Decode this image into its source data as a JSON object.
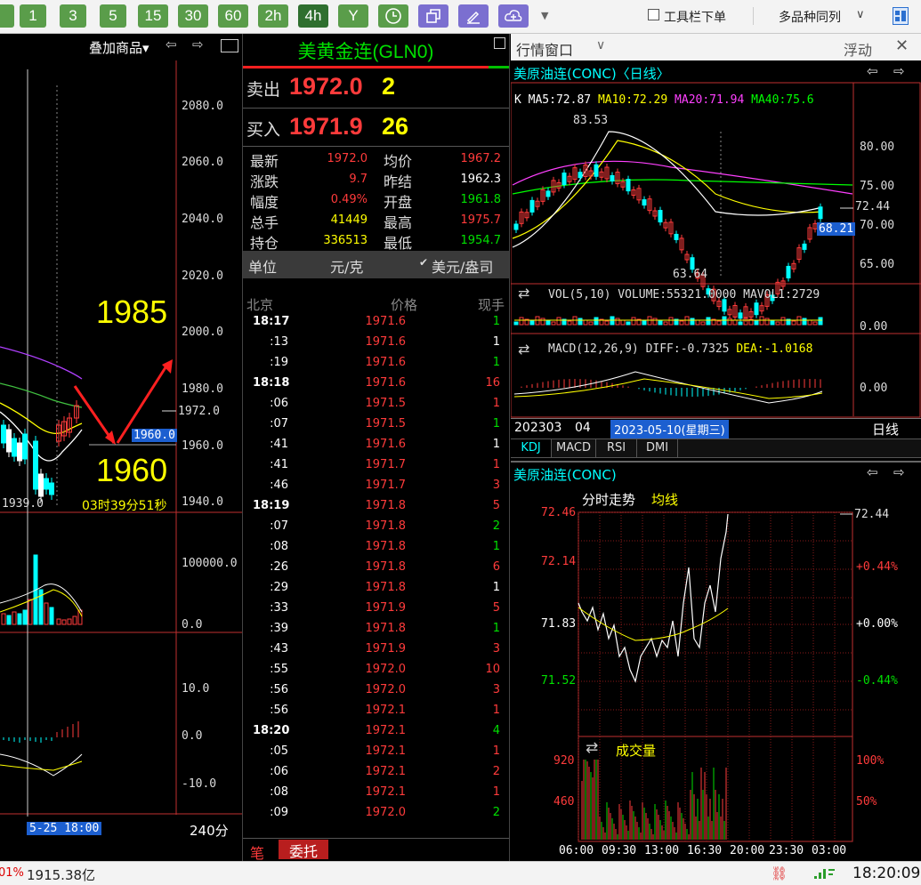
{
  "toolbar": {
    "buttons": [
      "1",
      "3",
      "5",
      "15",
      "30",
      "60",
      "2h",
      "4h",
      "Y"
    ],
    "toolbar_dock_label": "工具栏下单",
    "multi_layout_label": "多品种同列"
  },
  "left_chart": {
    "overlay_label": "叠加商品▾",
    "price_ticks": [
      "2080.0",
      "2060.0",
      "2040.0",
      "2020.0",
      "2000.0",
      "1980.0",
      "1960.0",
      "1940.0"
    ],
    "marker_high": "1985",
    "marker_low": "1960",
    "last_price_tag": "1972.0",
    "cursor_price_tag": "1960.0",
    "low_label": "1939.0",
    "countdown": "03时39分51秒",
    "vol_ticks": [
      "100000.0",
      "0.0"
    ],
    "macd_ticks": [
      "10.0",
      "0.0",
      "-10.0"
    ],
    "date_cursor": "5-25 18:00",
    "period": "240分",
    "colors": {
      "volume_up": "#ff3b3b",
      "volume_down": "#00ffff",
      "ma_yellow": "#ffff00",
      "ma_purple": "#b040ff"
    }
  },
  "quote": {
    "title": "美黄金连(GLN0)",
    "ask_label": "卖出",
    "ask_price": "1972.0",
    "ask_size": "2",
    "bid_label": "买入",
    "bid_price": "1971.9",
    "bid_size": "26",
    "fields": [
      {
        "l1": "最新",
        "v1": "1972.0",
        "c1": "#ff3b3b",
        "l2": "均价",
        "v2": "1967.2",
        "c2": "#ff3b3b"
      },
      {
        "l1": "涨跌",
        "v1": "9.7",
        "c1": "#ff3b3b",
        "l2": "昨结",
        "v2": "1962.3",
        "c2": "#ffffff"
      },
      {
        "l1": "幅度",
        "v1": "0.49%",
        "c1": "#ff3b3b",
        "l2": "开盘",
        "v2": "1961.8",
        "c2": "#00e000"
      },
      {
        "l1": "总手",
        "v1": "41449",
        "c1": "#ffff00",
        "l2": "最高",
        "v2": "1975.7",
        "c2": "#ff3b3b"
      },
      {
        "l1": "持仓",
        "v1": "336513",
        "c1": "#ffff00",
        "l2": "最低",
        "v2": "1954.7",
        "c2": "#00e000"
      }
    ],
    "unit_label": "单位",
    "unit_cny": "元/克",
    "unit_usd": "美元/盎司",
    "tick_headers": {
      "time": "北京",
      "price": "价格",
      "vol": "现手"
    },
    "ticks": [
      {
        "t": "18:17",
        "p": "1971.6",
        "v": "1",
        "c": "#00e000",
        "b": true
      },
      {
        "t": ":13",
        "p": "1971.6",
        "v": "1",
        "c": "#ffffff"
      },
      {
        "t": ":19",
        "p": "1971.6",
        "v": "1",
        "c": "#00e000"
      },
      {
        "t": "18:18",
        "p": "1971.6",
        "v": "16",
        "c": "#ff3b3b",
        "b": true
      },
      {
        "t": ":06",
        "p": "1971.5",
        "v": "1",
        "c": "#ff3b3b"
      },
      {
        "t": ":07",
        "p": "1971.5",
        "v": "1",
        "c": "#00e000"
      },
      {
        "t": ":41",
        "p": "1971.6",
        "v": "1",
        "c": "#ffffff"
      },
      {
        "t": ":41",
        "p": "1971.7",
        "v": "1",
        "c": "#ff3b3b"
      },
      {
        "t": ":46",
        "p": "1971.7",
        "v": "3",
        "c": "#ff3b3b"
      },
      {
        "t": "18:19",
        "p": "1971.8",
        "v": "5",
        "c": "#ff3b3b",
        "b": true
      },
      {
        "t": ":07",
        "p": "1971.8",
        "v": "2",
        "c": "#00e000"
      },
      {
        "t": ":08",
        "p": "1971.8",
        "v": "1",
        "c": "#00e000"
      },
      {
        "t": ":26",
        "p": "1971.8",
        "v": "6",
        "c": "#ff3b3b"
      },
      {
        "t": ":29",
        "p": "1971.8",
        "v": "1",
        "c": "#ffffff"
      },
      {
        "t": ":33",
        "p": "1971.9",
        "v": "5",
        "c": "#ff3b3b"
      },
      {
        "t": ":39",
        "p": "1971.8",
        "v": "1",
        "c": "#00e000"
      },
      {
        "t": ":43",
        "p": "1971.9",
        "v": "3",
        "c": "#ff3b3b"
      },
      {
        "t": ":55",
        "p": "1972.0",
        "v": "10",
        "c": "#ff3b3b"
      },
      {
        "t": ":56",
        "p": "1972.0",
        "v": "3",
        "c": "#ff3b3b"
      },
      {
        "t": ":56",
        "p": "1972.1",
        "v": "1",
        "c": "#ff3b3b"
      },
      {
        "t": "18:20",
        "p": "1972.1",
        "v": "4",
        "c": "#00e000",
        "b": true
      },
      {
        "t": ":05",
        "p": "1972.1",
        "v": "1",
        "c": "#ff3b3b"
      },
      {
        "t": ":06",
        "p": "1972.1",
        "v": "2",
        "c": "#ff3b3b"
      },
      {
        "t": ":08",
        "p": "1972.1",
        "v": "1",
        "c": "#ff3b3b"
      },
      {
        "t": ":09",
        "p": "1972.0",
        "v": "2",
        "c": "#00e000"
      }
    ],
    "bottom_tab_1": "笔",
    "bottom_tab_2": "委托"
  },
  "right_panel": {
    "window_title": "行情窗口",
    "float_label": "浮动",
    "kline_title": "美原油连(CONC)〈日线〉",
    "ma_k": "K",
    "ma5": "MA5:72.87",
    "ma10": "MA10:72.29",
    "ma20": "MA20:71.94",
    "ma40": "MA40:75.6",
    "hi_label": "83.53",
    "lo_label": "63.64",
    "price_ticks": [
      "80.00",
      "75.00",
      "70.00",
      "65.00"
    ],
    "last_tag": "72.44",
    "cursor_tag": "68.21",
    "vol_label": "VOL(5,10) VOLUME:55321.0000 MAVOL1:2729",
    "vol_tick": "0.00",
    "macd_label_main": "MACD(12,26,9) DIFF:-0.7325",
    "macd_label_dea": "DEA:-1.0168",
    "macd_tick": "0.00",
    "date_left": "202303",
    "date_mid": "04",
    "date_cursor": "2023-05-10(星期三)",
    "period": "日线",
    "indicator_tabs": [
      "KDJ",
      "MACD",
      "RSI",
      "DMI"
    ],
    "intraday_title": "美原油连(CONC)",
    "intraday_sub": "分时走势",
    "intraday_avg": "均线",
    "intraday_prices": [
      "72.46",
      "72.14",
      "71.83",
      "71.52"
    ],
    "intraday_pcts": [
      "+0.44%",
      "+0.00%",
      "-0.44%"
    ],
    "intraday_last": "72.44",
    "volume_title": "成交量",
    "vol_ticks": [
      "920",
      "460"
    ],
    "vol_pcts": [
      "100%",
      "50%"
    ],
    "times": [
      "06:00",
      "09:30",
      "13:00",
      "16:30",
      "20:00",
      "23:30",
      "03:00"
    ]
  },
  "statusbar": {
    "left_fragment": "01%",
    "amount": "1915.38亿",
    "clock": "18:20:09"
  }
}
